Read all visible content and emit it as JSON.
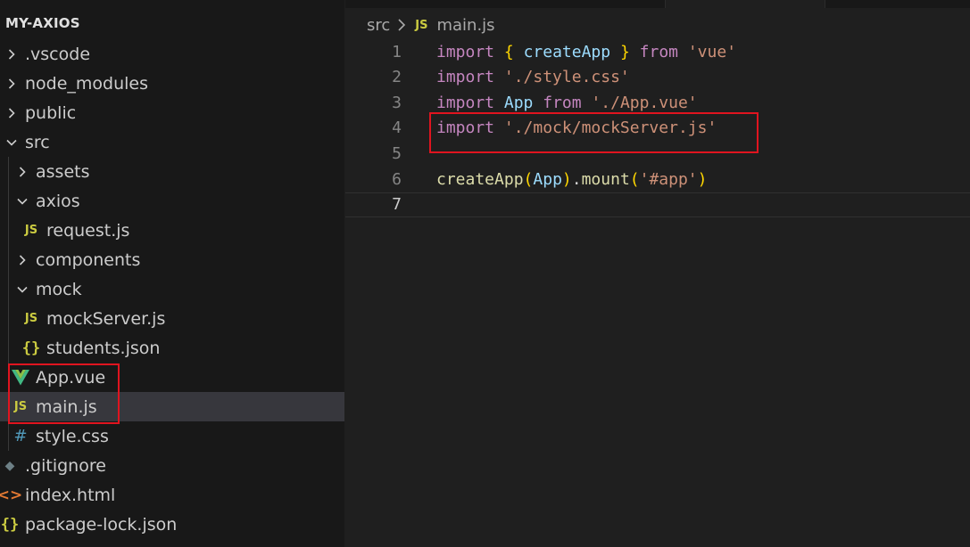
{
  "explorer": {
    "title": "MY-AXIOS",
    "tree": [
      {
        "label": ".vscode",
        "type": "folder",
        "expanded": false,
        "depth": 0,
        "icon": "chevron-right-icon"
      },
      {
        "label": "node_modules",
        "type": "folder",
        "expanded": false,
        "depth": 0,
        "icon": "chevron-right-icon"
      },
      {
        "label": "public",
        "type": "folder",
        "expanded": false,
        "depth": 0,
        "icon": "chevron-right-icon"
      },
      {
        "label": "src",
        "type": "folder",
        "expanded": true,
        "depth": 0,
        "icon": "chevron-down-icon"
      },
      {
        "label": "assets",
        "type": "folder",
        "expanded": false,
        "depth": 1,
        "icon": "chevron-right-icon"
      },
      {
        "label": "axios",
        "type": "folder",
        "expanded": true,
        "depth": 1,
        "icon": "chevron-down-icon"
      },
      {
        "label": "request.js",
        "type": "file",
        "depth": 2,
        "icon": "js-file-icon",
        "glyph": "JS"
      },
      {
        "label": "components",
        "type": "folder",
        "expanded": false,
        "depth": 1,
        "icon": "chevron-right-icon"
      },
      {
        "label": "mock",
        "type": "folder",
        "expanded": true,
        "depth": 1,
        "icon": "chevron-down-icon"
      },
      {
        "label": "mockServer.js",
        "type": "file",
        "depth": 2,
        "icon": "js-file-icon",
        "glyph": "JS"
      },
      {
        "label": "students.json",
        "type": "file",
        "depth": 2,
        "icon": "json-file-icon",
        "glyph": "{}"
      },
      {
        "label": "App.vue",
        "type": "file",
        "depth": 1,
        "icon": "vue-file-icon",
        "glyph": ""
      },
      {
        "label": "main.js",
        "type": "file",
        "depth": 1,
        "icon": "js-file-icon",
        "glyph": "JS",
        "selected": true
      },
      {
        "label": "style.css",
        "type": "file",
        "depth": 1,
        "icon": "css-file-icon",
        "glyph": "#"
      },
      {
        "label": ".gitignore",
        "type": "file",
        "depth": 0,
        "icon": "git-file-icon",
        "glyph": "◆"
      },
      {
        "label": "index.html",
        "type": "file",
        "depth": 0,
        "icon": "html-file-icon",
        "glyph": "<>"
      },
      {
        "label": "package-lock.json",
        "type": "file",
        "depth": 0,
        "icon": "json-file-icon",
        "glyph": "{}"
      }
    ]
  },
  "breadcrumb": {
    "folder": "src",
    "file_icon": "JS",
    "file": "main.js"
  },
  "editor": {
    "active_line": 7,
    "lines": [
      {
        "n": "1",
        "tokens": [
          [
            "kw",
            "import"
          ],
          [
            "pun",
            " "
          ],
          [
            "br1",
            "{"
          ],
          [
            "pun",
            " "
          ],
          [
            "id",
            "createApp"
          ],
          [
            "pun",
            " "
          ],
          [
            "br1",
            "}"
          ],
          [
            "pun",
            " "
          ],
          [
            "kw",
            "from"
          ],
          [
            "pun",
            " "
          ],
          [
            "str",
            "'vue'"
          ]
        ]
      },
      {
        "n": "2",
        "tokens": [
          [
            "kw",
            "import"
          ],
          [
            "pun",
            " "
          ],
          [
            "str",
            "'./style.css'"
          ]
        ]
      },
      {
        "n": "3",
        "tokens": [
          [
            "kw",
            "import"
          ],
          [
            "pun",
            " "
          ],
          [
            "id",
            "App"
          ],
          [
            "pun",
            " "
          ],
          [
            "kw",
            "from"
          ],
          [
            "pun",
            " "
          ],
          [
            "str",
            "'./App.vue'"
          ]
        ]
      },
      {
        "n": "4",
        "tokens": [
          [
            "kw",
            "import"
          ],
          [
            "pun",
            " "
          ],
          [
            "str",
            "'./mock/mockServer.js'"
          ]
        ]
      },
      {
        "n": "5",
        "tokens": []
      },
      {
        "n": "6",
        "tokens": [
          [
            "fn",
            "createApp"
          ],
          [
            "br1",
            "("
          ],
          [
            "id",
            "App"
          ],
          [
            "br1",
            ")"
          ],
          [
            "pun",
            "."
          ],
          [
            "fn",
            "mount"
          ],
          [
            "br1",
            "("
          ],
          [
            "str",
            "'#app'"
          ],
          [
            "br1",
            ")"
          ]
        ]
      },
      {
        "n": "7",
        "tokens": []
      }
    ]
  },
  "highlight_color": "#e0141f"
}
